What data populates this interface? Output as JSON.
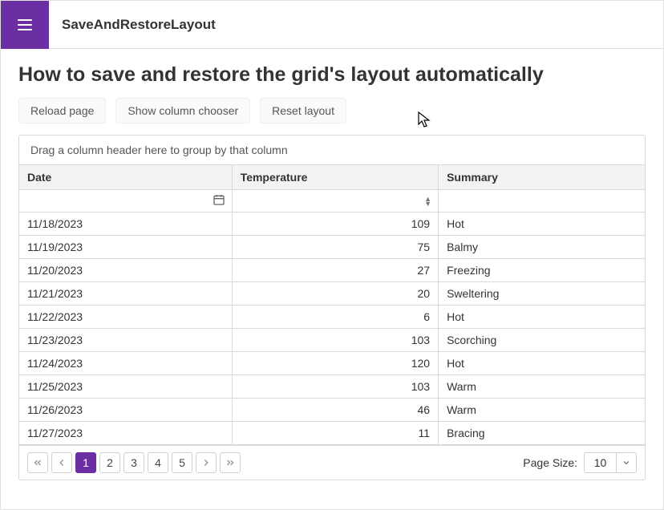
{
  "app": {
    "title": "SaveAndRestoreLayout"
  },
  "page": {
    "heading": "How to save and restore the grid's layout automatically"
  },
  "toolbar": {
    "reload": "Reload page",
    "chooser": "Show column chooser",
    "reset": "Reset layout"
  },
  "grid": {
    "group_panel": "Drag a column header here to group by that column",
    "columns": {
      "date": "Date",
      "temp": "Temperature",
      "summary": "Summary"
    },
    "rows": [
      {
        "date": "11/18/2023",
        "temp": 109,
        "summary": "Hot"
      },
      {
        "date": "11/19/2023",
        "temp": 75,
        "summary": "Balmy"
      },
      {
        "date": "11/20/2023",
        "temp": 27,
        "summary": "Freezing"
      },
      {
        "date": "11/21/2023",
        "temp": 20,
        "summary": "Sweltering"
      },
      {
        "date": "11/22/2023",
        "temp": 6,
        "summary": "Hot"
      },
      {
        "date": "11/23/2023",
        "temp": 103,
        "summary": "Scorching"
      },
      {
        "date": "11/24/2023",
        "temp": 120,
        "summary": "Hot"
      },
      {
        "date": "11/25/2023",
        "temp": 103,
        "summary": "Warm"
      },
      {
        "date": "11/26/2023",
        "temp": 46,
        "summary": "Warm"
      },
      {
        "date": "11/27/2023",
        "temp": 11,
        "summary": "Bracing"
      }
    ]
  },
  "pager": {
    "pages": [
      "1",
      "2",
      "3",
      "4",
      "5"
    ],
    "active": "1",
    "size_label": "Page Size:",
    "size_value": "10"
  }
}
